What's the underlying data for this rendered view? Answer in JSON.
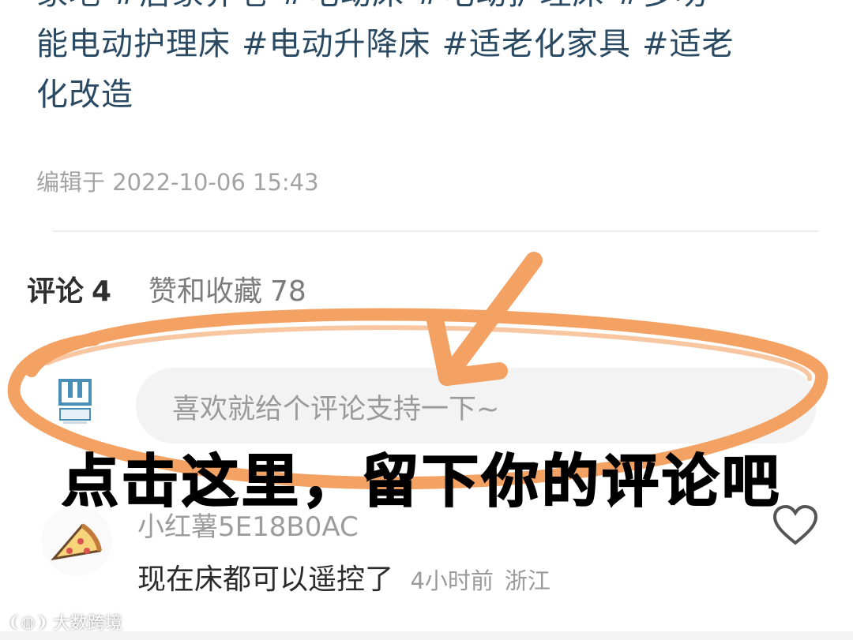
{
  "post": {
    "tags_line1": [
      "家地",
      "#居家养老",
      "#电动床",
      "#电动护理床",
      "#多功"
    ],
    "tags_line2": [
      "能电动护理床",
      "#电动升降床",
      "#适老化家具",
      "#适老"
    ],
    "tags_line3": [
      "化改造"
    ],
    "edit_label": "编辑于",
    "edit_time": "2022-10-06 15:43"
  },
  "tabs": {
    "comments_label": "评论",
    "comments_count": "4",
    "likes_label": "赞和收藏",
    "likes_count": "78"
  },
  "comment_input": {
    "placeholder": "喜欢就给个评论支持一下~"
  },
  "annotation": {
    "caption": "点击这里，留下你的评论吧",
    "color": "#f29a57"
  },
  "comments": [
    {
      "user": "小红薯5E18B0AC",
      "text": "现在床都可以遥控了",
      "time": "4小时前",
      "region": "浙江"
    }
  ],
  "watermark": {
    "text": "大数跨境"
  },
  "icons": {
    "avatar": "user-avatar-icon",
    "heart": "heart-icon",
    "pizza": "pizza-icon"
  }
}
